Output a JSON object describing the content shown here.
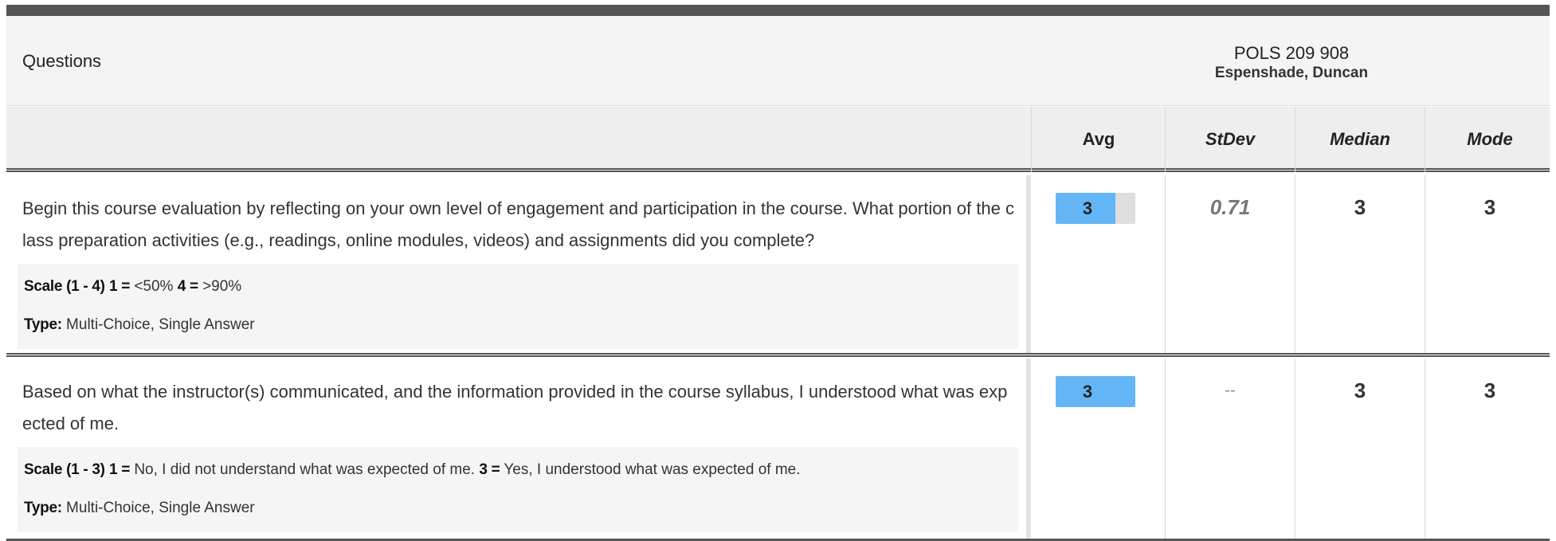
{
  "header": {
    "questions_label": "Questions",
    "course_code": "POLS 209 908",
    "instructor": "Espenshade, Duncan"
  },
  "columns": {
    "avg": "Avg",
    "stdev": "StDev",
    "median": "Median",
    "mode": "Mode"
  },
  "questions": [
    {
      "text": "Begin this course evaluation by reflecting on your own level of engagement and participation in the course. What portion of the class preparation activities (e.g., readings, online modules, videos) and assignments did you complete?",
      "scale_label": "Scale (1 - 4)",
      "scale_low_key": "1 =",
      "scale_low_text": "<50%",
      "scale_high_key": "4 =",
      "scale_high_text": ">90%",
      "type_label": "Type:",
      "type_value": "Multi-Choice, Single Answer",
      "avg": "3",
      "avg_fraction": 0.75,
      "stdev": "0.71",
      "median": "3",
      "mode": "3"
    },
    {
      "text": "Based on what the instructor(s) communicated, and the information provided in the course syllabus, I understood what was expected of me.",
      "scale_label": "Scale (1 - 3)",
      "scale_low_key": "1 =",
      "scale_low_text": "No, I did not understand what was expected of me.",
      "scale_high_key": "3 =",
      "scale_high_text": "Yes, I understood what was expected of me.",
      "type_label": "Type:",
      "type_value": "Multi-Choice, Single Answer",
      "avg": "3",
      "avg_fraction": 1.0,
      "stdev": "--",
      "median": "3",
      "mode": "3"
    }
  ],
  "colors": {
    "bar_fill": "#64b5f6",
    "bar_track": "#dedede",
    "top_bar": "#555555"
  }
}
